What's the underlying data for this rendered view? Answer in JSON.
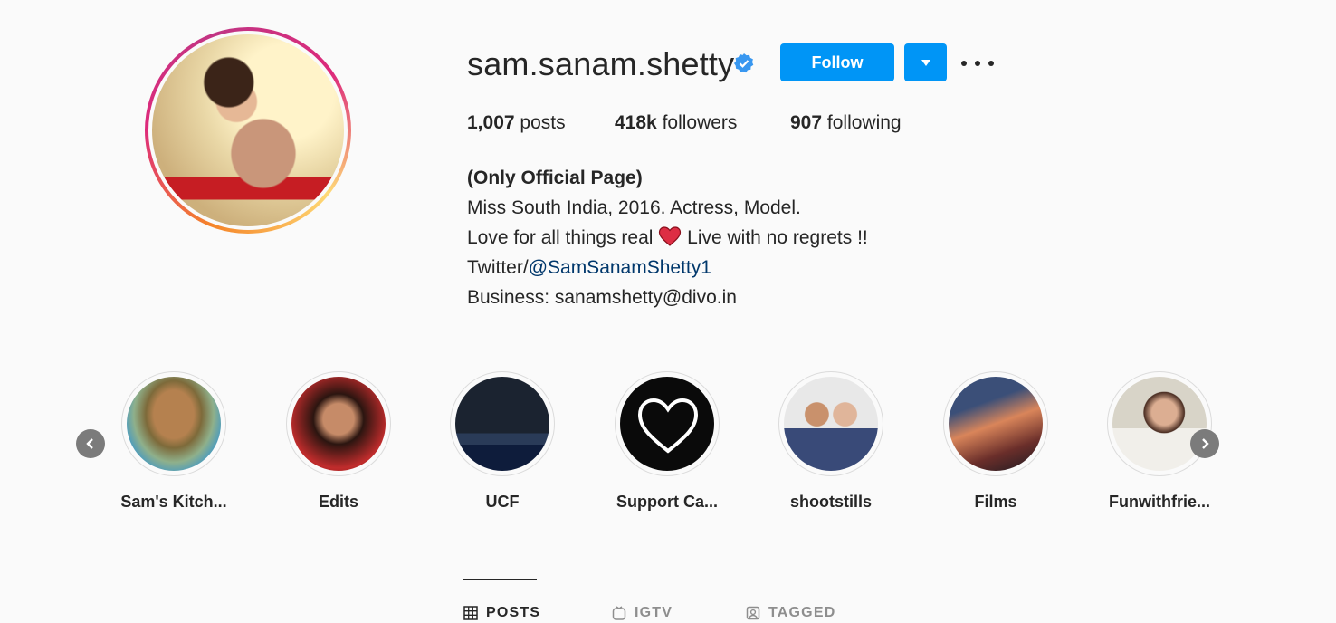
{
  "profile": {
    "username": "sam.sanam.shetty",
    "follow_label": "Follow",
    "stats": {
      "posts_count": "1,007",
      "posts_label": "posts",
      "followers_count": "418k",
      "followers_label": "followers",
      "following_count": "907",
      "following_label": "following"
    },
    "bio": {
      "name": "(Only Official Page)",
      "line1": "Miss South India, 2016. Actress, Model.",
      "line2a": "Love for all things real",
      "line2b": "Live with no regrets !!",
      "line3_prefix": "Twitter/",
      "line3_link": "@SamSanamShetty1",
      "line4": "Business: sanamshetty@divo.in"
    }
  },
  "highlights": [
    {
      "label": "Sam's Kitch..."
    },
    {
      "label": "Edits"
    },
    {
      "label": "UCF"
    },
    {
      "label": "Support Ca..."
    },
    {
      "label": "shootstills"
    },
    {
      "label": "Films"
    },
    {
      "label": "Funwithfrie..."
    }
  ],
  "tabs": [
    {
      "label": "POSTS",
      "active": true
    },
    {
      "label": "IGTV"
    },
    {
      "label": "TAGGED"
    }
  ],
  "colors": {
    "accent": "#0095f6",
    "text": "#262626",
    "muted": "#8e8e8e",
    "link": "#00376b"
  }
}
